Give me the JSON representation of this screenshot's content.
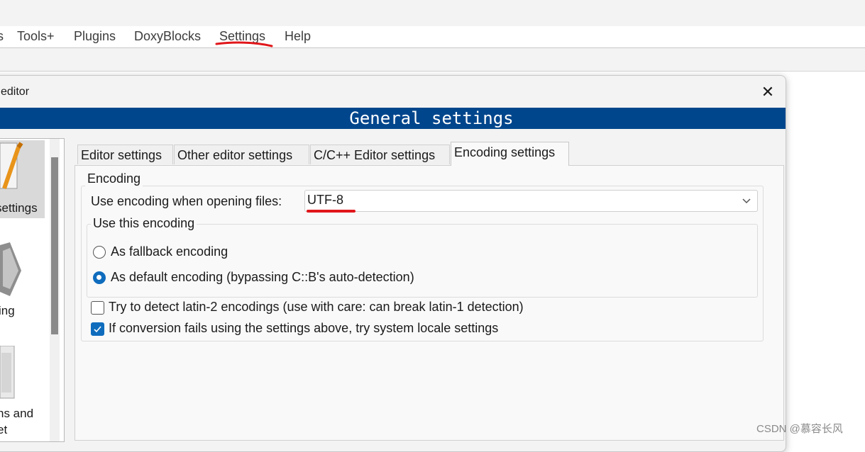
{
  "menubar": {
    "items": [
      "s",
      "Tools+",
      "Plugins",
      "DoxyBlocks",
      "Settings",
      "Help"
    ]
  },
  "dialog": {
    "title": "editor",
    "close_glyph": "✕",
    "banner": "General settings",
    "sidebar": {
      "items": [
        {
          "label": "settings",
          "icon": "editor-pencil-icon",
          "selected": true
        },
        {
          "label": "ing",
          "icon": "folding-icon",
          "selected": false
        },
        {
          "label": "ns and",
          "label2": "et",
          "icon": "abbreviations-document-icon",
          "selected": false
        }
      ]
    },
    "tabs": [
      {
        "label": "Editor settings",
        "active": false
      },
      {
        "label": "Other editor settings",
        "active": false
      },
      {
        "label": "C/C++ Editor settings",
        "active": false
      },
      {
        "label": "Encoding settings",
        "active": true
      }
    ],
    "encoding": {
      "group_title": "Encoding",
      "open_label": "Use encoding when opening files:",
      "selected_encoding": "UTF-8",
      "use_group_title": "Use this encoding",
      "radio_fallback": {
        "label": "As fallback encoding",
        "checked": false
      },
      "radio_default": {
        "label": "As default encoding (bypassing C::B's auto-detection)",
        "checked": true
      },
      "check_latin2": {
        "label": "Try to detect latin-2 encodings (use with care: can break latin-1 detection)",
        "checked": false
      },
      "check_locale": {
        "label": "If conversion fails using the settings above, try system locale settings",
        "checked": true
      }
    }
  },
  "watermark": "CSDN @慕容长风",
  "colors": {
    "banner": "#00468c",
    "accent": "#0f6cbd",
    "annotation": "#e0161a"
  }
}
